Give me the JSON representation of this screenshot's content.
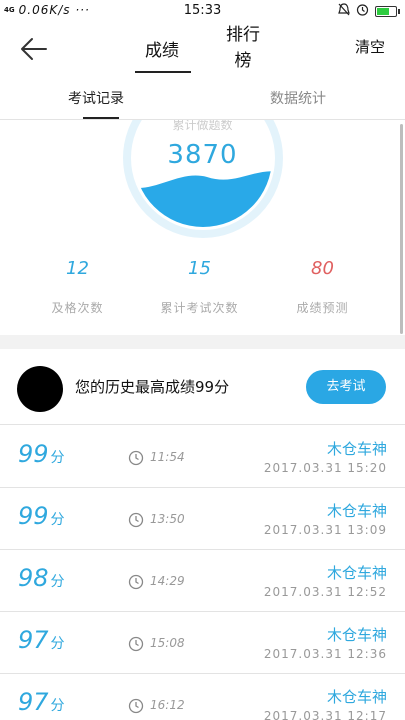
{
  "status_bar": {
    "signal": "4G",
    "speed": "0.06K/s ···",
    "time": "15:33",
    "icons": [
      "mute-icon",
      "alarm-icon",
      "battery-icon"
    ]
  },
  "nav": {
    "tab_score": "成绩",
    "tab_rank_line1": "排行",
    "tab_rank_line2": "榜",
    "clear": "清空"
  },
  "subtabs": {
    "records": "考试记录",
    "statistics": "数据统计"
  },
  "gauge": {
    "caption": "累计做题数",
    "value": "3870"
  },
  "stats": [
    {
      "value": "12",
      "label": "及格次数"
    },
    {
      "value": "15",
      "label": "累计考试次数"
    },
    {
      "value": "80",
      "label": "成绩预测"
    }
  ],
  "best": {
    "text": "您的历史最高成绩99分",
    "button": "去考试"
  },
  "records": [
    {
      "score": "99",
      "unit": "分",
      "time": "11:54",
      "name": "木仓车神",
      "date": "2017.03.31  15:20"
    },
    {
      "score": "99",
      "unit": "分",
      "time": "13:50",
      "name": "木仓车神",
      "date": "2017.03.31  13:09"
    },
    {
      "score": "98",
      "unit": "分",
      "time": "14:29",
      "name": "木仓车神",
      "date": "2017.03.31  12:52"
    },
    {
      "score": "97",
      "unit": "分",
      "time": "15:08",
      "name": "木仓车神",
      "date": "2017.03.31  12:36"
    },
    {
      "score": "97",
      "unit": "分",
      "time": "16:12",
      "name": "木仓车神",
      "date": "2017.03.31  12:17"
    }
  ],
  "colors": {
    "accent": "#2fa8de",
    "button": "#2aa7e4",
    "prediction": "#e06060"
  }
}
